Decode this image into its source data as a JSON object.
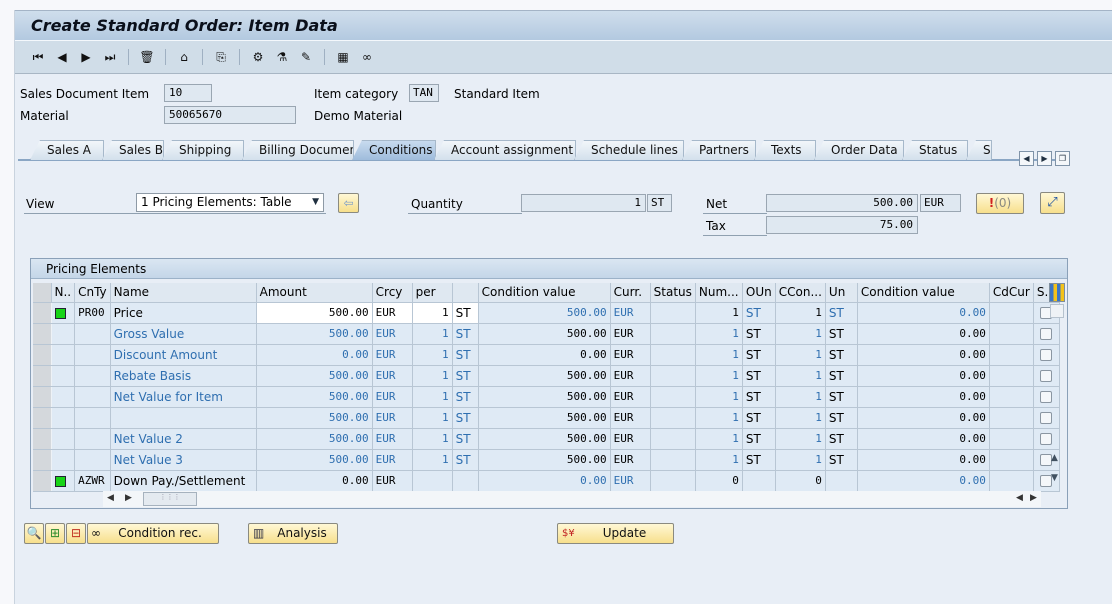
{
  "window": {
    "title": "Create Standard Order: Item Data"
  },
  "toolbar": {
    "buttons": [
      {
        "name": "first-page-icon",
        "glyph": "⏮"
      },
      {
        "name": "previous-page-icon",
        "glyph": "◀"
      },
      {
        "name": "next-page-icon",
        "glyph": "▶"
      },
      {
        "name": "last-page-icon",
        "glyph": "⏭"
      },
      {
        "name": "delete-icon",
        "glyph": "🗑"
      },
      {
        "name": "header-icon",
        "glyph": "⌂"
      },
      {
        "name": "document-flow-icon",
        "glyph": "⎘"
      },
      {
        "name": "configuration-icon",
        "glyph": "⚙"
      },
      {
        "name": "batch-icon",
        "glyph": "⚗"
      },
      {
        "name": "edit-item-icon",
        "glyph": "✎"
      },
      {
        "name": "calculator-icon",
        "glyph": "▦"
      },
      {
        "name": "display-icon",
        "glyph": "∞"
      }
    ]
  },
  "header": {
    "sales_doc_item_label": "Sales Document Item",
    "sales_doc_item_value": "10",
    "material_label": "Material",
    "material_value": "50065670",
    "material_desc": "Demo Material",
    "item_category_label": "Item category",
    "item_category_value": "TAN",
    "item_category_desc": "Standard Item"
  },
  "tabs": [
    {
      "label": "Sales A",
      "active": false
    },
    {
      "label": "Sales B",
      "active": false
    },
    {
      "label": "Shipping",
      "active": false
    },
    {
      "label": "Billing Document",
      "active": false
    },
    {
      "label": "Conditions",
      "active": true
    },
    {
      "label": "Account assignment",
      "active": false
    },
    {
      "label": "Schedule lines",
      "active": false
    },
    {
      "label": "Partners",
      "active": false
    },
    {
      "label": "Texts",
      "active": false
    },
    {
      "label": "Order Data",
      "active": false
    },
    {
      "label": "Status",
      "active": false
    },
    {
      "label": "S",
      "active": false
    }
  ],
  "conditions": {
    "view_label": "View",
    "view_value": "1 Pricing Elements: Table",
    "quantity_label": "Quantity",
    "quantity_value": "1",
    "quantity_unit": "ST",
    "net_label": "Net",
    "net_value": "500.00",
    "net_currency": "EUR",
    "tax_label": "Tax",
    "tax_value": "75.00",
    "messages_label": "(0)"
  },
  "pricing_table": {
    "title": "Pricing Elements",
    "columns": [
      "N..",
      "CnTy",
      "Name",
      "Amount",
      "Crcy",
      "per",
      "",
      "Condition value",
      "Curr.",
      "Status",
      "Num...",
      "OUn",
      "CCon...",
      "Un",
      "Condition value",
      "CdCur",
      "S..."
    ],
    "rows": [
      {
        "status": true,
        "cnty": "PR00",
        "name": "Price",
        "amount": "500.00",
        "crcy": "EUR",
        "per": "1",
        "uom": "ST",
        "cond_value": "500.00",
        "curr": "EUR",
        "cstatus": "",
        "num": "1",
        "oun": "ST",
        "ccon": "1",
        "un": "ST",
        "cond_value2": "0.00",
        "cdcur": "",
        "style": "editable"
      },
      {
        "status": false,
        "cnty": "",
        "name": "Gross Value",
        "amount": "500.00",
        "crcy": "EUR",
        "per": "1",
        "uom": "ST",
        "cond_value": "500.00",
        "curr": "EUR",
        "cstatus": "",
        "num": "1",
        "oun": "ST",
        "ccon": "1",
        "un": "ST",
        "cond_value2": "0.00",
        "cdcur": "",
        "style": "subtotal"
      },
      {
        "status": false,
        "cnty": "",
        "name": "Discount Amount",
        "amount": "0.00",
        "crcy": "EUR",
        "per": "1",
        "uom": "ST",
        "cond_value": "0.00",
        "curr": "EUR",
        "cstatus": "",
        "num": "1",
        "oun": "ST",
        "ccon": "1",
        "un": "ST",
        "cond_value2": "0.00",
        "cdcur": "",
        "style": "subtotal"
      },
      {
        "status": false,
        "cnty": "",
        "name": "Rebate Basis",
        "amount": "500.00",
        "crcy": "EUR",
        "per": "1",
        "uom": "ST",
        "cond_value": "500.00",
        "curr": "EUR",
        "cstatus": "",
        "num": "1",
        "oun": "ST",
        "ccon": "1",
        "un": "ST",
        "cond_value2": "0.00",
        "cdcur": "",
        "style": "subtotal"
      },
      {
        "status": false,
        "cnty": "",
        "name": "Net Value for Item",
        "amount": "500.00",
        "crcy": "EUR",
        "per": "1",
        "uom": "ST",
        "cond_value": "500.00",
        "curr": "EUR",
        "cstatus": "",
        "num": "1",
        "oun": "ST",
        "ccon": "1",
        "un": "ST",
        "cond_value2": "0.00",
        "cdcur": "",
        "style": "subtotal"
      },
      {
        "status": false,
        "cnty": "",
        "name": "",
        "amount": "500.00",
        "crcy": "EUR",
        "per": "1",
        "uom": "ST",
        "cond_value": "500.00",
        "curr": "EUR",
        "cstatus": "",
        "num": "1",
        "oun": "ST",
        "ccon": "1",
        "un": "ST",
        "cond_value2": "0.00",
        "cdcur": "",
        "style": "subtotal"
      },
      {
        "status": false,
        "cnty": "",
        "name": "Net Value 2",
        "amount": "500.00",
        "crcy": "EUR",
        "per": "1",
        "uom": "ST",
        "cond_value": "500.00",
        "curr": "EUR",
        "cstatus": "",
        "num": "1",
        "oun": "ST",
        "ccon": "1",
        "un": "ST",
        "cond_value2": "0.00",
        "cdcur": "",
        "style": "subtotal"
      },
      {
        "status": false,
        "cnty": "",
        "name": "Net Value 3",
        "amount": "500.00",
        "crcy": "EUR",
        "per": "1",
        "uom": "ST",
        "cond_value": "500.00",
        "curr": "EUR",
        "cstatus": "",
        "num": "1",
        "oun": "ST",
        "ccon": "1",
        "un": "ST",
        "cond_value2": "0.00",
        "cdcur": "",
        "style": "subtotal"
      },
      {
        "status": true,
        "cnty": "AZWR",
        "name": "Down Pay./Settlement",
        "amount": "0.00",
        "crcy": "EUR",
        "per": "",
        "uom": "",
        "cond_value": "0.00",
        "curr": "EUR",
        "cstatus": "",
        "num": "0",
        "oun": "",
        "ccon": "0",
        "un": "",
        "cond_value2": "0.00",
        "cdcur": "",
        "style": "plain"
      }
    ]
  },
  "bottom_buttons": {
    "condition_rec": "Condition rec.",
    "analysis": "Analysis",
    "update": "Update"
  },
  "colors": {
    "status_green": "#18d418",
    "link_blue": "#2f6fb0",
    "button_yellow": "#f7df8c"
  }
}
